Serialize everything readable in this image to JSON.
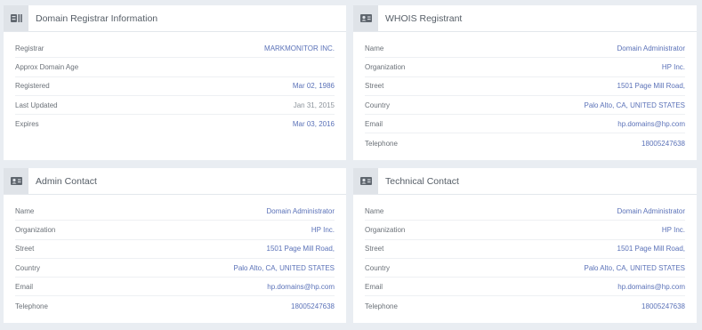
{
  "panels": {
    "registrar": {
      "title": "Domain Registrar Information",
      "icon": "server-list-icon",
      "rows": [
        {
          "label": "Registrar",
          "value": "MARKMONITOR INC."
        },
        {
          "label": "Approx Domain Age",
          "value": ""
        },
        {
          "label": "Registered",
          "value": "Mar 02, 1986"
        },
        {
          "label": "Last Updated",
          "value": "Jan 31, 2015"
        },
        {
          "label": "Expires",
          "value": "Mar 03, 2016"
        }
      ]
    },
    "whois": {
      "title": "WHOIS Registrant",
      "icon": "contact-card-icon",
      "rows": [
        {
          "label": "Name",
          "value": "Domain Administrator"
        },
        {
          "label": "Organization",
          "value": "HP Inc."
        },
        {
          "label": "Street",
          "value": "1501 Page Mill Road,"
        },
        {
          "label": "Country",
          "value": "Palo Alto, CA, UNITED STATES"
        },
        {
          "label": "Email",
          "value": "hp.domains@hp.com"
        },
        {
          "label": "Telephone",
          "value": "18005247638"
        }
      ]
    },
    "admin": {
      "title": "Admin Contact",
      "icon": "contact-card-icon",
      "rows": [
        {
          "label": "Name",
          "value": "Domain Administrator"
        },
        {
          "label": "Organization",
          "value": "HP Inc."
        },
        {
          "label": "Street",
          "value": "1501 Page Mill Road,"
        },
        {
          "label": "Country",
          "value": "Palo Alto, CA, UNITED STATES"
        },
        {
          "label": "Email",
          "value": "hp.domains@hp.com"
        },
        {
          "label": "Telephone",
          "value": "18005247638"
        }
      ]
    },
    "technical": {
      "title": "Technical Contact",
      "icon": "contact-card-icon",
      "rows": [
        {
          "label": "Name",
          "value": "Domain Administrator"
        },
        {
          "label": "Organization",
          "value": "HP Inc."
        },
        {
          "label": "Street",
          "value": "1501 Page Mill Road,"
        },
        {
          "label": "Country",
          "value": "Palo Alto, CA, UNITED STATES"
        },
        {
          "label": "Email",
          "value": "hp.domains@hp.com"
        },
        {
          "label": "Telephone",
          "value": "18005247638"
        }
      ]
    }
  }
}
